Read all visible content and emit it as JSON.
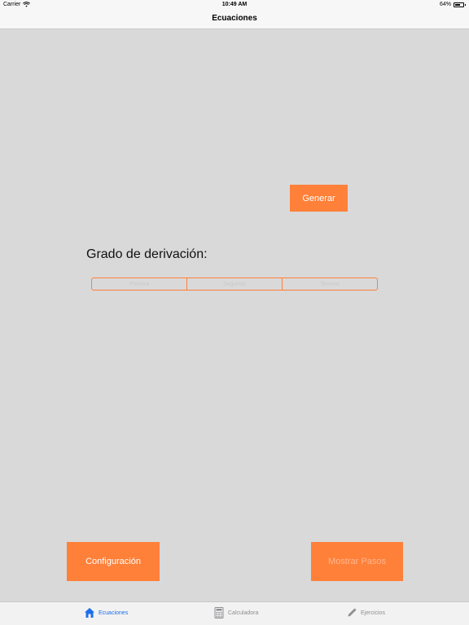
{
  "status_bar": {
    "carrier": "Carrier",
    "time": "10:49 AM",
    "battery": "64%",
    "battery_level": 0.64
  },
  "nav": {
    "title": "Ecuaciones"
  },
  "main": {
    "generate_button": "Generar",
    "derivation_label": "Grado de derivación:",
    "segments": [
      "Primera",
      "Segunda",
      "Tercera"
    ],
    "config_button": "Configuración",
    "show_steps_button": "Mostrar Pasos"
  },
  "tabs": [
    {
      "label": "Ecuaciones",
      "icon": "house-icon",
      "active": true
    },
    {
      "label": "Calculadora",
      "icon": "calculator-icon",
      "active": false
    },
    {
      "label": "Ejercicios",
      "icon": "pencil-icon",
      "active": false
    }
  ],
  "colors": {
    "accent": "#ff8039",
    "background": "#d9d9d9",
    "tab_active": "#1e6fe8",
    "tab_inactive": "#8e8e93"
  }
}
